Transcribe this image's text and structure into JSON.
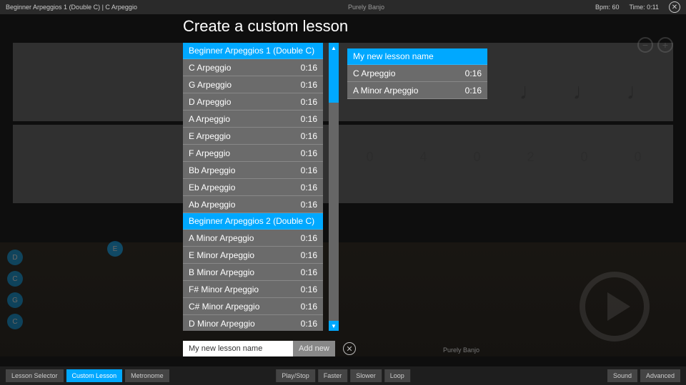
{
  "topbar": {
    "breadcrumb": "Beginner Arpeggios 1 (Double C)  |  C Arpeggio",
    "brand": "Purely Banjo",
    "bpm_label": "Bpm: 60",
    "time_label": "Time: 0:11"
  },
  "zoom": {
    "out": "−",
    "in": "+"
  },
  "modal": {
    "title": "Create a custom lesson",
    "source_groups": [
      {
        "header": "Beginner Arpeggios 1 (Double C)",
        "items": [
          {
            "name": "C Arpeggio",
            "dur": "0:16"
          },
          {
            "name": "G Arpeggio",
            "dur": "0:16"
          },
          {
            "name": "D Arpeggio",
            "dur": "0:16"
          },
          {
            "name": "A Arpeggio",
            "dur": "0:16"
          },
          {
            "name": "E Arpeggio",
            "dur": "0:16"
          },
          {
            "name": "F Arpeggio",
            "dur": "0:16"
          },
          {
            "name": "Bb Arpeggio",
            "dur": "0:16"
          },
          {
            "name": "Eb Arpeggio",
            "dur": "0:16"
          },
          {
            "name": "Ab Arpeggio",
            "dur": "0:16"
          }
        ]
      },
      {
        "header": "Beginner Arpeggios 2 (Double C)",
        "items": [
          {
            "name": "A Minor Arpeggio",
            "dur": "0:16"
          },
          {
            "name": "E Minor Arpeggio",
            "dur": "0:16"
          },
          {
            "name": "B Minor Arpeggio",
            "dur": "0:16"
          },
          {
            "name": "F# Minor Arpeggio",
            "dur": "0:16"
          },
          {
            "name": "C# Minor Arpeggio",
            "dur": "0:16"
          },
          {
            "name": "D Minor Arpeggio",
            "dur": "0:16"
          }
        ]
      }
    ],
    "dest_header": "My new lesson name",
    "dest_items": [
      {
        "name": "C Arpeggio",
        "dur": "0:16"
      },
      {
        "name": "A Minor Arpeggio",
        "dur": "0:16"
      }
    ],
    "input_value": "My new lesson name",
    "add_label": "Add new",
    "scroll_up": "▲",
    "scroll_down": "▼"
  },
  "footer_brand": "Purely Banjo",
  "bottombar": {
    "lesson_selector": "Lesson Selector",
    "custom_lesson": "Custom Lesson",
    "metronome": "Metronome",
    "play_stop": "Play/Stop",
    "faster": "Faster",
    "slower": "Slower",
    "loop": "Loop",
    "sound": "Sound",
    "advanced": "Advanced"
  },
  "chord_dots": [
    "D",
    "C",
    "G",
    "C"
  ],
  "dim_tab": [
    "0",
    "4",
    "0",
    "2",
    "0",
    "0"
  ],
  "chord_e": "E"
}
